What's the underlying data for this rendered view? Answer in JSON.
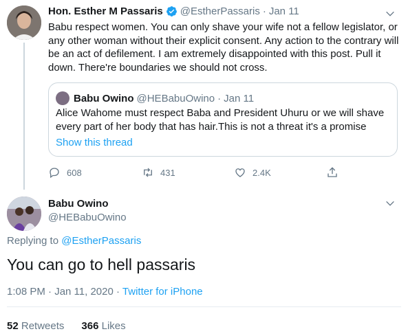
{
  "tweet1": {
    "name": "Hon. Esther M Passaris",
    "handle": "@EstherPassaris",
    "dot": "·",
    "date": "Jan 11",
    "text": "Babu respect women. You can only shave your wife not a fellow legislator, or any other woman without their explicit consent. Any action to the contrary will be an act of defilement. I am extremely disappointed with this post. Pull it down. There're boundaries we should not cross.",
    "quote": {
      "name": "Babu Owino",
      "handle": "@HEBabuOwino",
      "dot": "·",
      "date": "Jan 11",
      "text": "Alice Wahome must respect Baba and President Uhuru or we will shave every part of her body that has hair.This is not a threat it's a promise",
      "link": "Show this thread"
    },
    "actions": {
      "replies": "608",
      "retweets": "431",
      "likes": "2.4K"
    }
  },
  "tweet2": {
    "name": "Babu Owino",
    "handle": "@HEBabuOwino",
    "replying_prefix": "Replying to",
    "replying_to": "@EstherPassaris",
    "text": "You can go to hell passaris",
    "timestamp": "1:08 PM · Jan 11, 2020",
    "sep": "·",
    "source": "Twitter for iPhone",
    "retweets_count": "52",
    "retweets_label": "Retweets",
    "likes_count": "366",
    "likes_label": "Likes"
  },
  "colors": {
    "link": "#1da1f2",
    "muted": "#657786",
    "verified": "#1da1f2"
  },
  "icons": [
    "reply-icon",
    "retweet-icon",
    "like-icon",
    "share-icon",
    "verified-icon",
    "chevron-down-icon"
  ]
}
